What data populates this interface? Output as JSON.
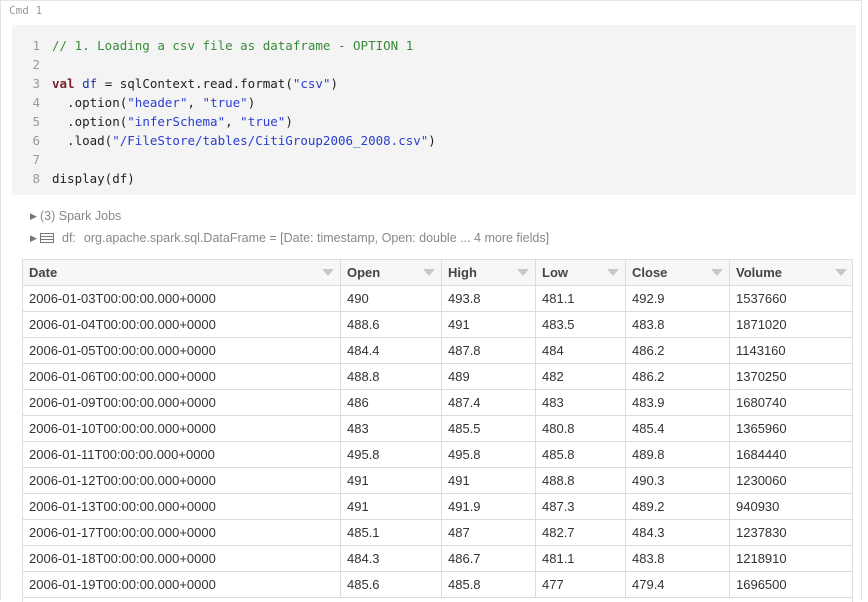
{
  "cell": {
    "cmd_label": "Cmd 1"
  },
  "code_lines": [
    {
      "n": "1",
      "parts": [
        {
          "t": "// 1. Loading a csv file as dataframe - OPTION 1",
          "c": "c-comment"
        }
      ]
    },
    {
      "n": "2",
      "parts": []
    },
    {
      "n": "3",
      "parts": [
        {
          "t": "val",
          "c": "c-kw"
        },
        {
          "t": " ",
          "c": "c-plain"
        },
        {
          "t": "df",
          "c": "c-var"
        },
        {
          "t": " = sqlContext.read.format(",
          "c": "c-plain"
        },
        {
          "t": "\"csv\"",
          "c": "c-str"
        },
        {
          "t": ")",
          "c": "c-plain"
        }
      ]
    },
    {
      "n": "4",
      "parts": [
        {
          "t": "  .option(",
          "c": "c-plain"
        },
        {
          "t": "\"header\"",
          "c": "c-str"
        },
        {
          "t": ", ",
          "c": "c-plain"
        },
        {
          "t": "\"true\"",
          "c": "c-str"
        },
        {
          "t": ")",
          "c": "c-plain"
        }
      ]
    },
    {
      "n": "5",
      "parts": [
        {
          "t": "  .option(",
          "c": "c-plain"
        },
        {
          "t": "\"inferSchema\"",
          "c": "c-str"
        },
        {
          "t": ", ",
          "c": "c-plain"
        },
        {
          "t": "\"true\"",
          "c": "c-str"
        },
        {
          "t": ")",
          "c": "c-plain"
        }
      ]
    },
    {
      "n": "6",
      "parts": [
        {
          "t": "  .load(",
          "c": "c-plain"
        },
        {
          "t": "\"/FileStore/tables/CitiGroup2006_2008.csv\"",
          "c": "c-str"
        },
        {
          "t": ")",
          "c": "c-plain"
        }
      ]
    },
    {
      "n": "7",
      "parts": []
    },
    {
      "n": "8",
      "parts": [
        {
          "t": "display(df)",
          "c": "c-plain"
        }
      ]
    }
  ],
  "output": {
    "spark_jobs": "(3) Spark Jobs",
    "df_name": "df:",
    "df_schema": "org.apache.spark.sql.DataFrame = [Date: timestamp, Open: double ... 4 more fields]"
  },
  "table": {
    "columns": [
      "Date",
      "Open",
      "High",
      "Low",
      "Close",
      "Volume"
    ],
    "rows": [
      [
        "2006-01-03T00:00:00.000+0000",
        "490",
        "493.8",
        "481.1",
        "492.9",
        "1537660"
      ],
      [
        "2006-01-04T00:00:00.000+0000",
        "488.6",
        "491",
        "483.5",
        "483.8",
        "1871020"
      ],
      [
        "2006-01-05T00:00:00.000+0000",
        "484.4",
        "487.8",
        "484",
        "486.2",
        "1143160"
      ],
      [
        "2006-01-06T00:00:00.000+0000",
        "488.8",
        "489",
        "482",
        "486.2",
        "1370250"
      ],
      [
        "2006-01-09T00:00:00.000+0000",
        "486",
        "487.4",
        "483",
        "483.9",
        "1680740"
      ],
      [
        "2006-01-10T00:00:00.000+0000",
        "483",
        "485.5",
        "480.8",
        "485.4",
        "1365960"
      ],
      [
        "2006-01-11T00:00:00.000+0000",
        "495.8",
        "495.8",
        "485.8",
        "489.8",
        "1684440"
      ],
      [
        "2006-01-12T00:00:00.000+0000",
        "491",
        "491",
        "488.8",
        "490.3",
        "1230060"
      ],
      [
        "2006-01-13T00:00:00.000+0000",
        "491",
        "491.9",
        "487.3",
        "489.2",
        "940930"
      ],
      [
        "2006-01-17T00:00:00.000+0000",
        "485.1",
        "487",
        "482.7",
        "484.3",
        "1237830"
      ],
      [
        "2006-01-18T00:00:00.000+0000",
        "484.3",
        "486.7",
        "481.1",
        "483.8",
        "1218910"
      ],
      [
        "2006-01-19T00:00:00.000+0000",
        "485.6",
        "485.8",
        "477",
        "479.4",
        "1696500"
      ]
    ]
  }
}
